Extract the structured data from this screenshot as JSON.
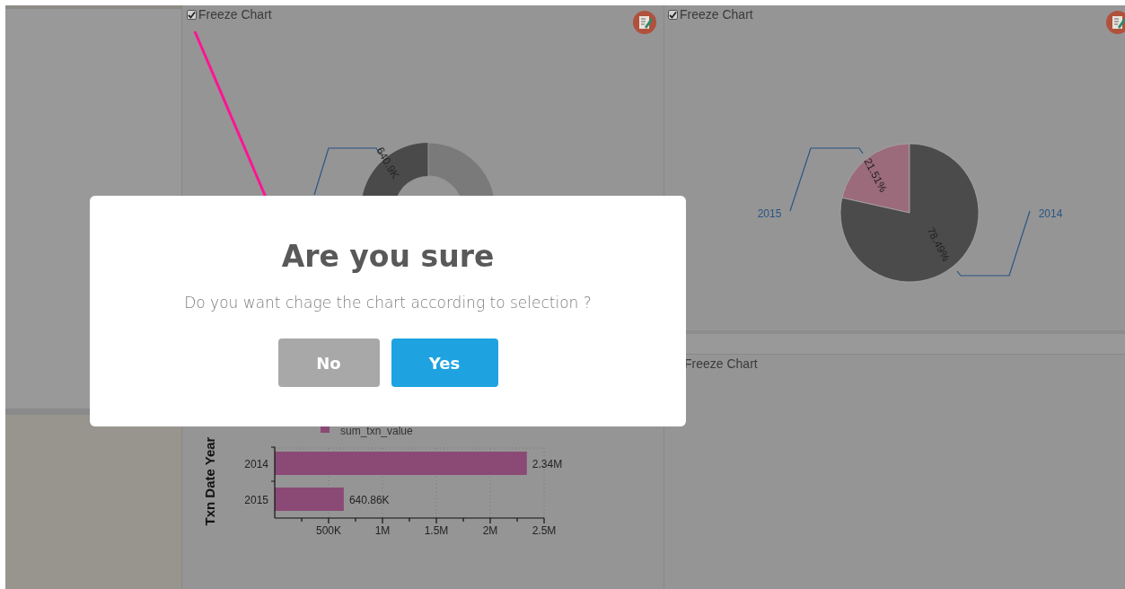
{
  "dashboard": {
    "center_panel": {
      "freeze": {
        "label": "Freeze Chart",
        "checked": true
      },
      "donut": {
        "slice_label": "640.9K"
      },
      "bar_chart": {
        "chart_data": {
          "type": "bar",
          "orientation": "horizontal",
          "ylabel": "Txn Date Year",
          "categories": [
            "2014",
            "2015"
          ],
          "series": [
            {
              "name": "sum_txn_value",
              "color": "#8b4a75",
              "values": [
                2340000,
                640860
              ]
            }
          ],
          "xlim": [
            0,
            2500000
          ],
          "xticks": [
            {
              "value": 500000,
              "label": "500K"
            },
            {
              "value": 1000000,
              "label": "1M"
            },
            {
              "value": 1500000,
              "label": "1.5M"
            },
            {
              "value": 2000000,
              "label": "2M"
            },
            {
              "value": 2500000,
              "label": "2.5M"
            }
          ],
          "grid": true,
          "value_labels": [
            "2.34M",
            "640.86K"
          ]
        }
      }
    },
    "right_top_panel": {
      "freeze": {
        "label": "Freeze Chart",
        "checked": true
      },
      "chart_data": {
        "type": "pie",
        "categories": [
          "2015",
          "2014"
        ],
        "values": [
          21.51,
          78.49
        ],
        "value_labels": [
          "21.51%",
          "78.49%"
        ]
      }
    },
    "right_bottom_panel": {
      "freeze": {
        "label": "Freeze Chart"
      }
    }
  },
  "dialog": {
    "title": "Are you sure",
    "message": "Do you want chage the chart according to selection ?",
    "buttons": [
      {
        "label": "No",
        "kind": "cancel"
      },
      {
        "label": "Yes",
        "kind": "confirm"
      }
    ]
  }
}
